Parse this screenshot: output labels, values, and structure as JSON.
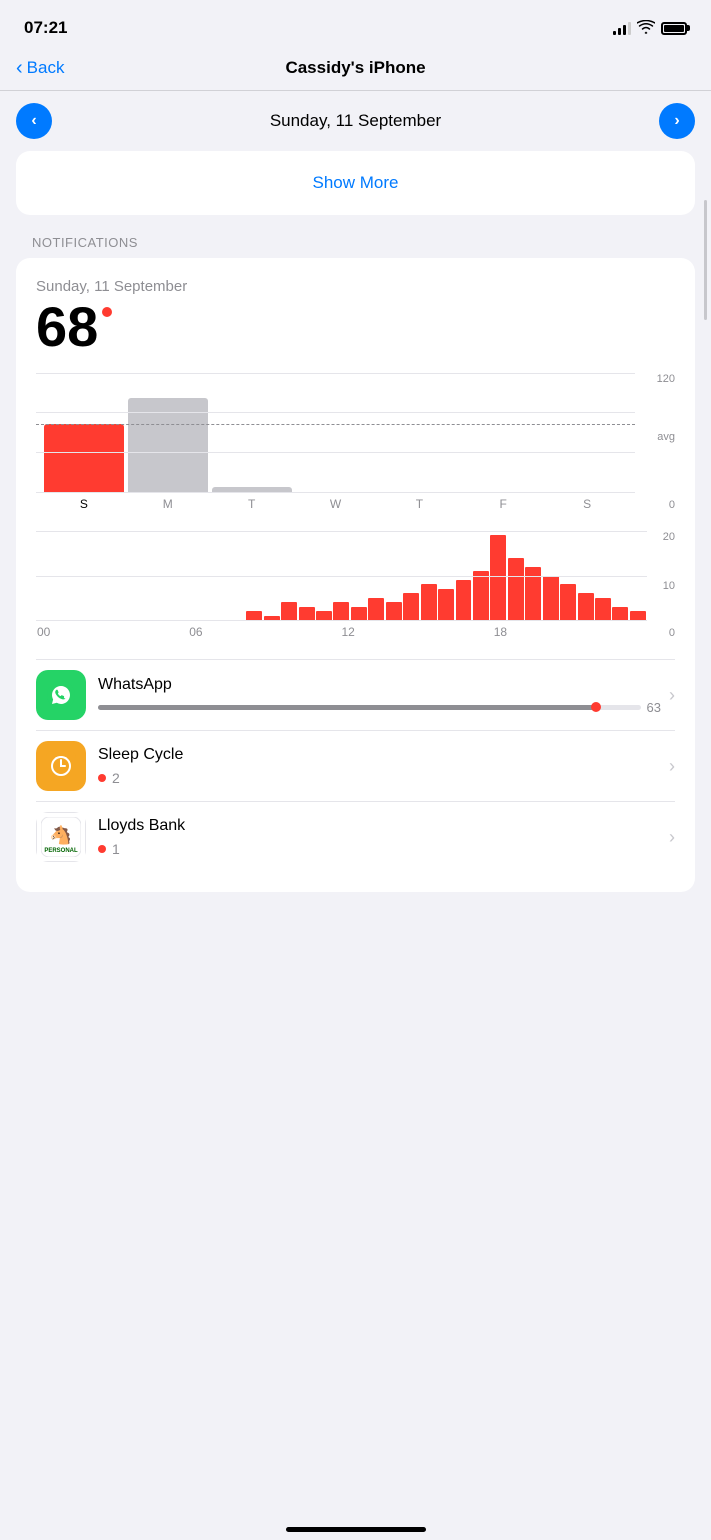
{
  "statusBar": {
    "time": "07:21",
    "battery": "full"
  },
  "navBar": {
    "back_label": "Back",
    "title": "Cassidy's iPhone"
  },
  "dateNav": {
    "date": "Sunday, 11 September",
    "prev_label": "‹",
    "next_label": "›"
  },
  "showMore": {
    "label": "Show More"
  },
  "sections": {
    "notifications_header": "NOTIFICATIONS"
  },
  "notificationsCard": {
    "date": "Sunday, 11 September",
    "count": "68",
    "weeklyChart": {
      "y_max": 120,
      "y_mid": "avg",
      "avg_pct": 58,
      "bars": [
        {
          "day": "S",
          "value": 68,
          "pct": 57,
          "color": "red",
          "active": true
        },
        {
          "day": "M",
          "value": 95,
          "pct": 79,
          "color": "gray",
          "active": false
        },
        {
          "day": "T",
          "value": 5,
          "pct": 4,
          "color": "gray",
          "active": false
        },
        {
          "day": "W",
          "value": 0,
          "pct": 0,
          "color": "gray",
          "active": false
        },
        {
          "day": "T",
          "value": 0,
          "pct": 0,
          "color": "gray",
          "active": false
        },
        {
          "day": "F",
          "value": 0,
          "pct": 0,
          "color": "gray",
          "active": false
        },
        {
          "day": "S",
          "value": 0,
          "pct": 0,
          "color": "gray",
          "active": false
        }
      ],
      "y_labels": [
        "120",
        "0"
      ]
    },
    "hourlyChart": {
      "y_max": 20,
      "y_labels": [
        "20",
        "10",
        "0"
      ],
      "x_labels": [
        "00",
        "06",
        "12",
        "18",
        ""
      ],
      "bars": [
        0,
        0,
        0,
        0,
        0,
        0,
        0,
        0,
        0,
        0,
        0,
        0,
        2,
        1,
        4,
        3,
        2,
        4,
        3,
        5,
        4,
        6,
        8,
        7,
        9,
        11,
        19,
        14,
        12,
        10,
        8,
        6,
        5,
        3,
        2
      ]
    },
    "apps": [
      {
        "name": "WhatsApp",
        "count": 63,
        "icon": "whatsapp",
        "has_progress": true,
        "progress_pct": 92
      },
      {
        "name": "Sleep Cycle",
        "count": 2,
        "icon": "sleepcycle",
        "has_progress": false
      },
      {
        "name": "Lloyds Bank",
        "count": 1,
        "icon": "lloyds",
        "has_progress": false
      }
    ]
  }
}
